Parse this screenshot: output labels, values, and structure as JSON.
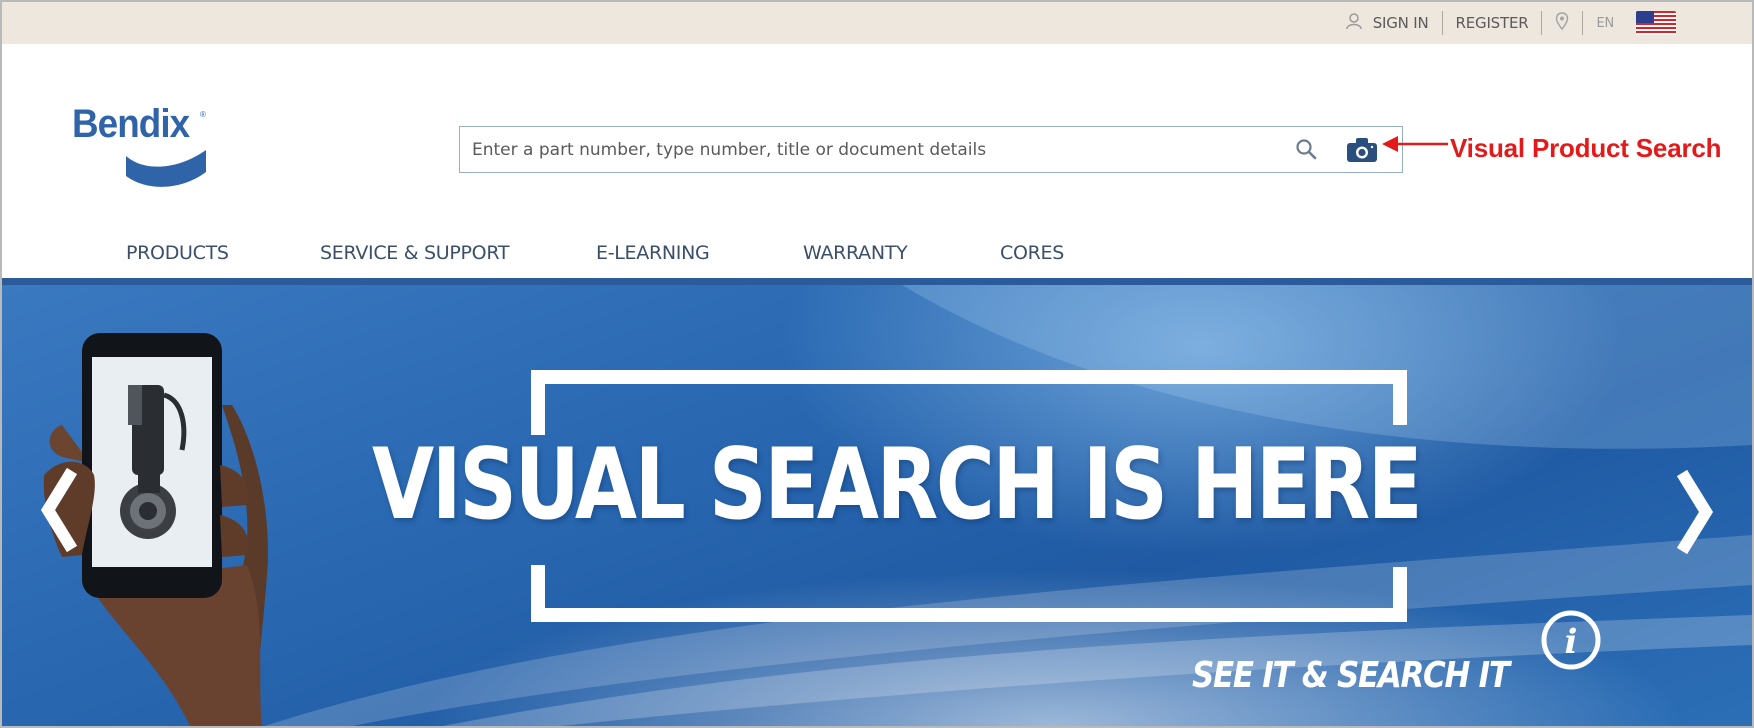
{
  "utility": {
    "sign_in": "SIGN IN",
    "register": "REGISTER",
    "language": "EN",
    "icons": [
      "user-icon",
      "map-pin-icon",
      "us-flag-icon"
    ]
  },
  "brand": {
    "logo_text": "Bendix",
    "logo_tm": "®",
    "color": "#2f64a9"
  },
  "search": {
    "placeholder": "Enter a part number, type number, title or document details",
    "icons": [
      "search-icon",
      "camera-icon"
    ]
  },
  "callout": {
    "label": "Visual Product Search",
    "color": "#e41a1a"
  },
  "nav": {
    "items": [
      {
        "label": "PRODUCTS"
      },
      {
        "label": "SERVICE & SUPPORT"
      },
      {
        "label": "E-LEARNING"
      },
      {
        "label": "WARRANTY"
      },
      {
        "label": "CORES"
      }
    ],
    "rule_color": "#2b5b9a"
  },
  "hero": {
    "title": "VISUAL SEARCH IS HERE",
    "subtitle": "SEE IT & SEARCH IT",
    "info_symbol": "i",
    "prev_symbol": "❮",
    "next_symbol": "❯"
  }
}
